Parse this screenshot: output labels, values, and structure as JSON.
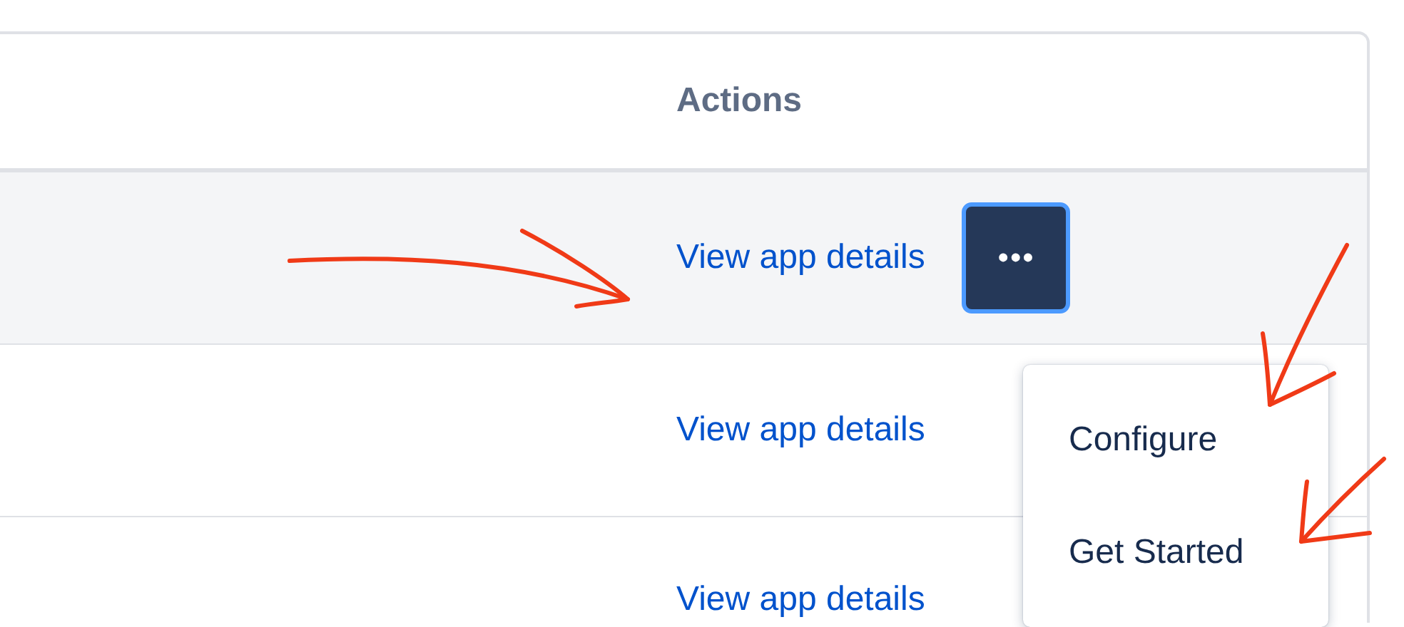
{
  "table": {
    "columns": [
      {
        "label": "Actions"
      }
    ],
    "more_button": "•••",
    "rows": [
      {
        "action_link": "View app details",
        "highlighted": true
      },
      {
        "action_link": "View app details",
        "highlighted": false
      },
      {
        "action_link": "View app details",
        "highlighted": false
      }
    ]
  },
  "menu": {
    "open": true,
    "items": [
      {
        "label": "Configure"
      },
      {
        "label": "Get Started"
      }
    ]
  }
}
